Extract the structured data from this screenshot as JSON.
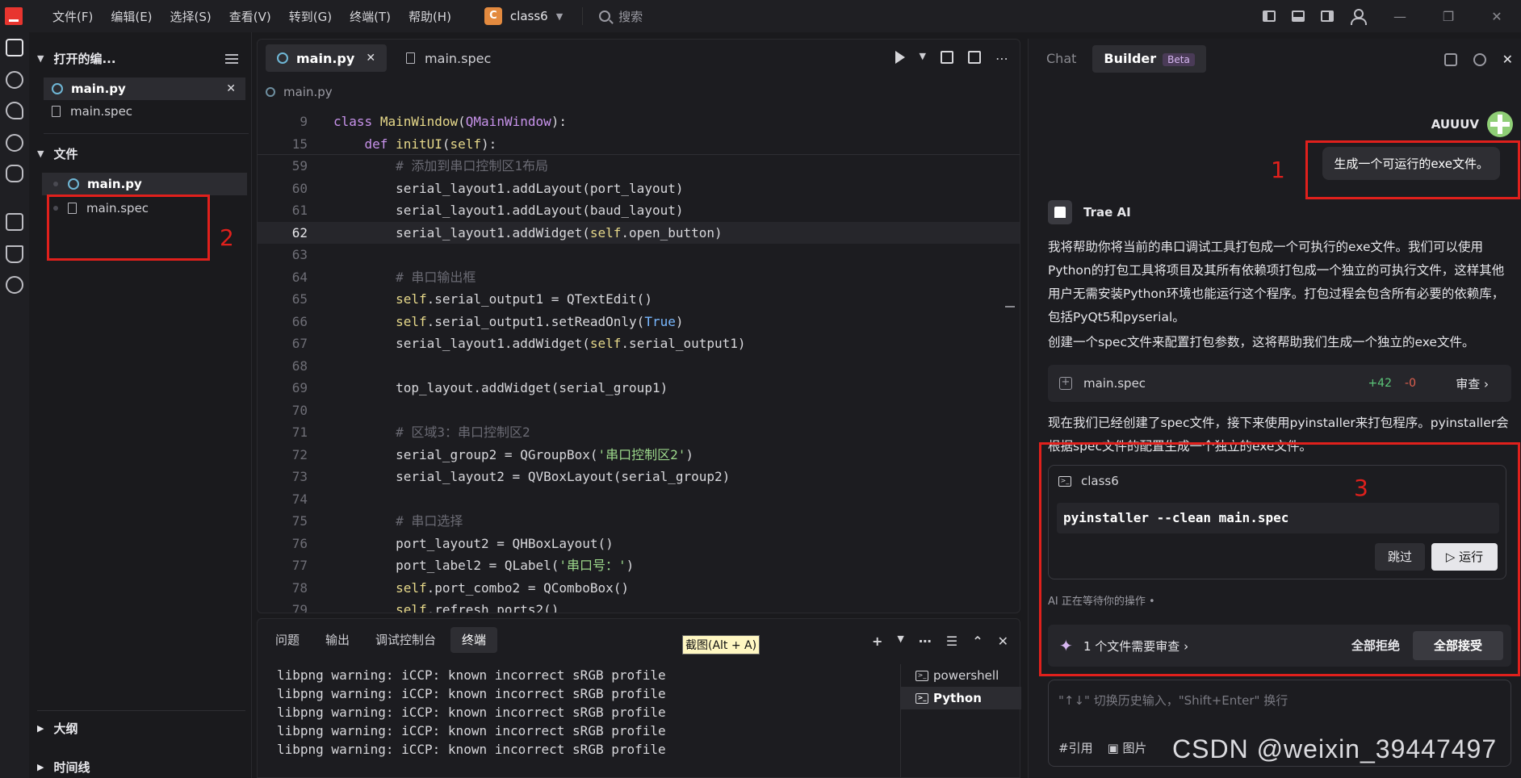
{
  "titlebar": {
    "menus": [
      "文件(F)",
      "编辑(E)",
      "选择(S)",
      "查看(V)",
      "转到(G)",
      "终端(T)",
      "帮助(H)"
    ],
    "project_badge": "C",
    "project_name": "class6",
    "search_label": "搜索"
  },
  "sidebar": {
    "open_editors_title": "打开的编...",
    "open_editors": [
      {
        "name": "main.py",
        "selected": true
      },
      {
        "name": "main.spec",
        "selected": false
      }
    ],
    "files_title": "文件",
    "files": [
      {
        "name": "main.py",
        "selected": true
      },
      {
        "name": "main.spec",
        "selected": false
      }
    ],
    "outline_title": "大纲",
    "timeline_title": "时间线"
  },
  "editor": {
    "tabs": [
      {
        "name": "main.py",
        "active": true
      },
      {
        "name": "main.spec",
        "active": false
      }
    ],
    "breadcrumb": "main.py",
    "current_line": "62"
  },
  "panel": {
    "tabs": [
      "问题",
      "输出",
      "调试控制台",
      "终端"
    ],
    "active_tab": "终端",
    "screenshot_tip": "截图(Alt + A)",
    "terminal_lines": [
      "libpng warning: iCCP: known incorrect sRGB profile",
      "libpng warning: iCCP: known incorrect sRGB profile",
      "libpng warning: iCCP: known incorrect sRGB profile",
      "libpng warning: iCCP: known incorrect sRGB profile",
      "libpng warning: iCCP: known incorrect sRGB profile"
    ],
    "terminals": [
      {
        "name": "powershell",
        "selected": false
      },
      {
        "name": "Python",
        "selected": true
      }
    ]
  },
  "chat": {
    "tab_chat": "Chat",
    "tab_builder": "Builder",
    "beta_label": "Beta",
    "user_name": "AUUUV",
    "user_message": "生成一个可运行的exe文件。",
    "ai_name": "Trae AI",
    "ai_para1": "我将帮助你将当前的串口调试工具打包成一个可执行的exe文件。我们可以使用Python的打包工具将项目及其所有依赖项打包成一个独立的可执行文件，这样其他用户无需安装Python环境也能运行这个程序。打包过程会包含所有必要的依赖库，包括PyQt5和pyserial。",
    "ai_para2": "创建一个spec文件来配置打包参数，这将帮助我们生成一个独立的exe文件。",
    "file_card": {
      "name": "main.spec",
      "added": "+42",
      "removed": "-0",
      "review": "审查 ›"
    },
    "ai_para3": "现在我们已经创建了spec文件，接下来使用pyinstaller来打包程序。pyinstaller会根据spec文件的配置生成一个独立的exe文件。",
    "run_card": {
      "terminal": "class6",
      "command": "pyinstaller --clean main.spec",
      "skip": "跳过",
      "run": "▷ 运行"
    },
    "wait_text": "AI 正在等待你的操作 •",
    "review_bar": {
      "text": "1  个文件需要审查  ›",
      "reject": "全部拒绝",
      "accept": "全部接受"
    },
    "input_placeholder": "\"↑↓\" 切换历史输入，\"Shift+Enter\" 换行",
    "input_tools": [
      "#引用",
      "▣ 图片"
    ]
  },
  "annotations": [
    "1",
    "2",
    "3"
  ],
  "watermark": "CSDN @weixin_39447497",
  "colors": {
    "annotation_red": "#e0201c",
    "accent_green": "#5cc77a",
    "accent_purple": "#c792ea"
  }
}
